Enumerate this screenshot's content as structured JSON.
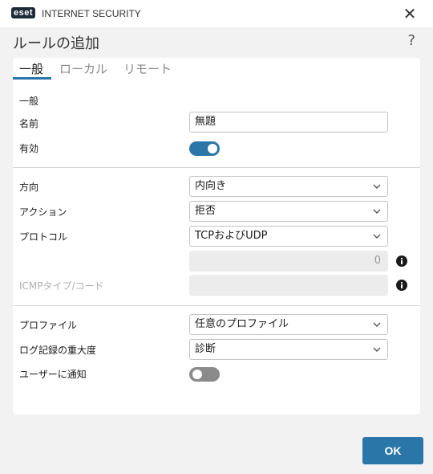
{
  "app": {
    "logo_text": "eset",
    "product_name": "INTERNET SECURITY",
    "close_glyph": "✕"
  },
  "dialog": {
    "title": "ルールの追加",
    "help_glyph": "?"
  },
  "tabs": [
    {
      "label": "一般",
      "active": true
    },
    {
      "label": "ローカル",
      "active": false
    },
    {
      "label": "リモート",
      "active": false
    }
  ],
  "general": {
    "section_title": "一般",
    "name_label": "名前",
    "name_value": "無題",
    "enabled_label": "有効",
    "enabled": true
  },
  "traffic": {
    "direction_label": "方向",
    "direction_value": "内向き",
    "action_label": "アクション",
    "action_value": "拒否",
    "protocol_label": "プロトコル",
    "protocol_value": "TCPおよびUDP",
    "protocol_number_value": "0",
    "icmp_label": "ICMPタイプ/コード",
    "icmp_value": ""
  },
  "profile": {
    "profile_label": "プロファイル",
    "profile_value": "任意のプロファイル",
    "log_label": "ログ記録の重大度",
    "log_value": "診断",
    "notify_label": "ユーザーに通知",
    "notify": false
  },
  "footer": {
    "ok_label": "OK"
  },
  "icons": [
    "close-icon",
    "help-icon",
    "chevron-down-icon",
    "info-icon"
  ],
  "colors": {
    "accent": "#2a76a8",
    "toggle_off": "#8a8a8a",
    "background": "#f2f2f2"
  }
}
